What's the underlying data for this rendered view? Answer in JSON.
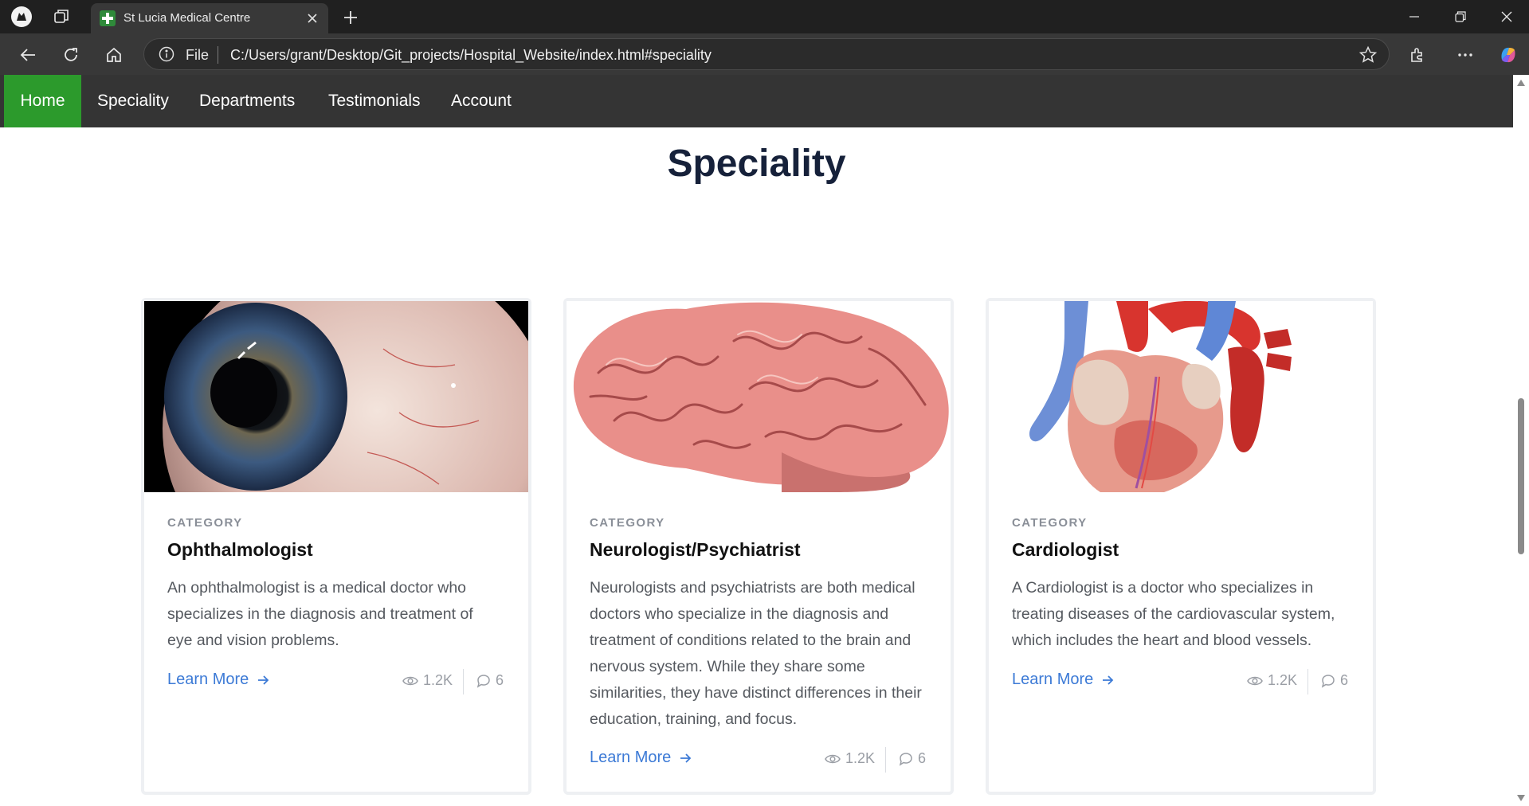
{
  "browser": {
    "tab_title": "St Lucia Medical Centre",
    "address_prefix": "File",
    "url": "C:/Users/grant/Desktop/Git_projects/Hospital_Website/index.html#speciality"
  },
  "nav": {
    "items": [
      {
        "label": "Home"
      },
      {
        "label": "Speciality"
      },
      {
        "label": "Departments"
      },
      {
        "label": "Testimonials"
      },
      {
        "label": "Account"
      }
    ]
  },
  "section": {
    "title": "Speciality"
  },
  "cards": [
    {
      "category": "CATEGORY",
      "title": "Ophthalmologist",
      "description": "An ophthalmologist is a medical doctor who specializes in the diagnosis and treatment of eye and vision problems.",
      "link": "Learn More",
      "views": "1.2K",
      "comments": "6",
      "image": "eye-closeup"
    },
    {
      "category": "CATEGORY",
      "title": "Neurologist/Psychiatrist",
      "description": "Neurologists and psychiatrists are both medical doctors who specialize in the diagnosis and treatment of conditions related to the brain and nervous system. While they share some similarities, they have distinct differences in their education, training, and focus.",
      "link": "Learn More",
      "views": "1.2K",
      "comments": "6",
      "image": "brain-illustration"
    },
    {
      "category": "CATEGORY",
      "title": "Cardiologist",
      "description": "A Cardiologist is a doctor who specializes in treating diseases of the cardiovascular system, which includes the heart and blood vessels.",
      "link": "Learn More",
      "views": "1.2K",
      "comments": "6",
      "image": "heart-illustration"
    }
  ],
  "colors": {
    "nav_bg": "#343434",
    "nav_active": "#2c9a2c",
    "link": "#3c7ad6",
    "title": "#16213a"
  }
}
